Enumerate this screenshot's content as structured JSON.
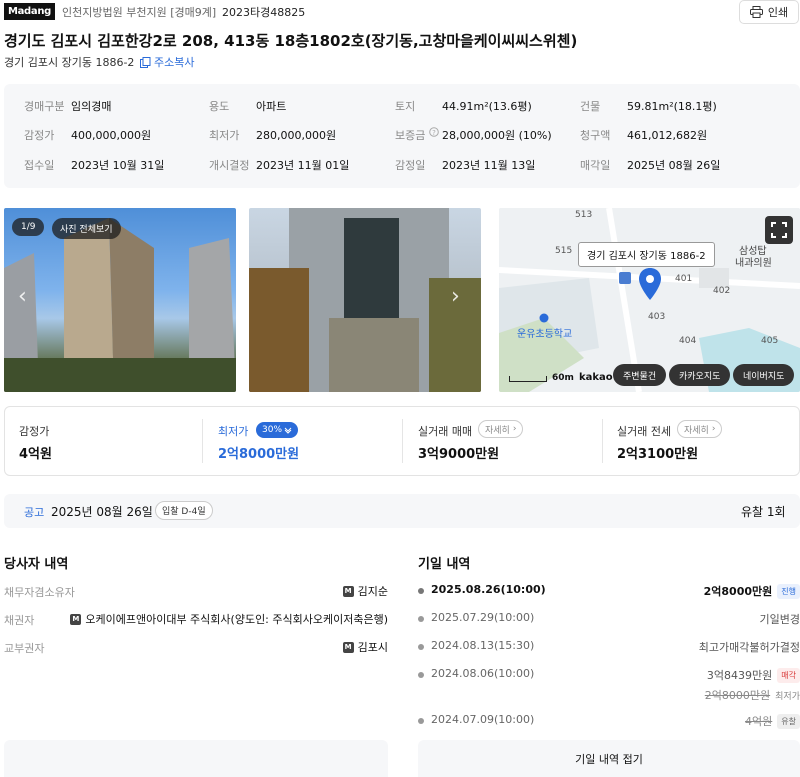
{
  "header": {
    "logo": "Madang",
    "court": "인천지방법원 부천지원 [경매9계]",
    "case_no": "2023타경48825",
    "print_label": "인쇄"
  },
  "title": "경기도 김포시 김포한강2로 208, 413동 18층1802호(장기동,고창마을케이씨씨스위첸)",
  "sub_address": "경기 김포시 장기동 1886-2",
  "copy_address_label": "주소복사",
  "info": {
    "r1": [
      {
        "label": "경매구분",
        "value": "임의경매"
      },
      {
        "label": "용도",
        "value": "아파트"
      },
      {
        "label": "토지",
        "value": "44.91m²(13.6평)"
      },
      {
        "label": "건물",
        "value": "59.81m²(18.1평)"
      }
    ],
    "r2": [
      {
        "label": "감정가",
        "value": "400,000,000원"
      },
      {
        "label": "최저가",
        "value": "280,000,000원"
      },
      {
        "label": "보증금",
        "value": "28,000,000원 (10%)"
      },
      {
        "label": "청구액",
        "value": "461,012,682원"
      }
    ],
    "r3": [
      {
        "label": "접수일",
        "value": "2023년 10월 31일"
      },
      {
        "label": "개시결정",
        "value": "2023년 11월 01일"
      },
      {
        "label": "감정일",
        "value": "2023년 11월 13일"
      },
      {
        "label": "매각일",
        "value": "2025년 08월 26일"
      }
    ]
  },
  "gallery": {
    "counter": "1/9",
    "view_all": "사진 전체보기"
  },
  "map": {
    "popup": "경기 김포시 장기동 1886-2",
    "labels": {
      "b513": "513",
      "b515": "515",
      "b401": "401",
      "b402": "402",
      "b403": "403",
      "b404": "404",
      "b405": "405",
      "school": "운유초등학교",
      "bank1": "삼성탑",
      "bank2": "내과의원",
      "scale": "60m",
      "brand": "kakao"
    },
    "btn_nearby": "주변물건",
    "btn_kakao": "카카오지도",
    "btn_naver": "네이버지도"
  },
  "prices": {
    "appraisal_label": "감정가",
    "appraisal_value": "4억원",
    "min_label": "최저가",
    "min_pct": "30%",
    "min_value": "2억8000만원",
    "sale_label": "실거래 매매",
    "sale_detail": "자세히",
    "sale_value": "3억9000만원",
    "jeonse_label": "실거래 전세",
    "jeonse_detail": "자세히",
    "jeonse_value": "2억3100만원"
  },
  "notice": {
    "label": "공고",
    "date": "2025년 08월 26일",
    "dday": "입찰 D-4일",
    "fail_count": "유찰 1회"
  },
  "parties": {
    "title": "당사자 내역",
    "rows": [
      {
        "label": "채무자겸소유자",
        "value": "김지순"
      },
      {
        "label": "채권자",
        "value": "오케이에프앤아이대부 주식회사(양도인: 주식회사오케이저축은행)"
      },
      {
        "label": "교부권자",
        "value": "김포시"
      }
    ],
    "m_badge": "M"
  },
  "dates": {
    "title": "기일 내역",
    "rows": [
      {
        "date": "2025.08.26(10:00)",
        "value": "2억8000만원",
        "tag": "진행"
      },
      {
        "date": "2025.07.29(10:00)",
        "value": "기일변경"
      },
      {
        "date": "2024.08.13(15:30)",
        "value": "최고가매각불허가결정"
      },
      {
        "date": "2024.08.06(10:00)",
        "value": "3억8439만원",
        "tag": "매각",
        "sub_strike": "2억8000만원",
        "sub_note": "최저가"
      },
      {
        "date": "2024.07.09(10:00)",
        "strike": "4억원",
        "tag": "유찰"
      }
    ],
    "collapse_label": "기일 내역 접기"
  }
}
